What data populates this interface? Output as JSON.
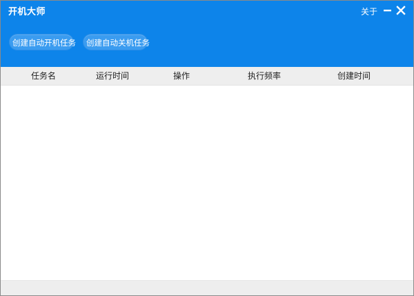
{
  "window": {
    "title": "开机大师",
    "about_label": "关于",
    "minimize_icon": "minimize-icon",
    "close_icon": "close-icon"
  },
  "toolbar": {
    "create_startup_label": "创建自动开机任务",
    "create_shutdown_label": "创建自动关机任务"
  },
  "table": {
    "columns": [
      "任务名",
      "运行时间",
      "操作",
      "执行频率",
      "创建时间"
    ],
    "rows": []
  },
  "colors": {
    "accent": "#0d84ea",
    "button": "#3b9cf0",
    "header_bg": "#eeeeee"
  }
}
